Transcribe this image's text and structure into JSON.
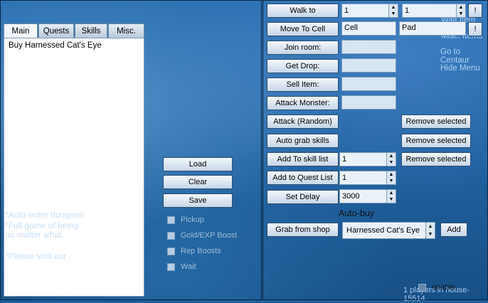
{
  "tabs": [
    "Main",
    "Quests",
    "Skills",
    "Misc."
  ],
  "list_items": [
    "Buy Harnessed Cat's Eye"
  ],
  "left_buttons": {
    "load": "Load",
    "clear": "Clear",
    "save": "Save"
  },
  "checkboxes": [
    "Pickup",
    "Gold/EXP Boost",
    "Rep Boosts",
    "Wait"
  ],
  "ghost_text": [
    "*Auto-enter dungeon",
    "*Full game of being",
    "no matter what.",
    "*Please visit our"
  ],
  "right": {
    "walk_to": "Walk to",
    "walk_x": "1",
    "walk_y": "1",
    "bang": "!",
    "move_to_cell": "Move To Cell",
    "cell": "Cell",
    "pad": "Pad",
    "join_room": "Join room:",
    "get_drop": "Get Drop:",
    "sell_item": "Sell Item:",
    "attack_monster": "Attack Monster:",
    "attack_random": "Attack (Random)",
    "auto_grab_skills": "Auto grab skills",
    "add_to_skill_list": "Add To skill list",
    "skill_value": "1",
    "add_to_quest_list": "Add to Quest List",
    "quest_value": "1",
    "set_delay": "Set Delay",
    "delay_value": "3000",
    "remove_selected": "Remove selected",
    "auto_buy": "Auto-buy",
    "grab_from_shop": "Grab from shop",
    "shop_item": "Harnessed Cat's Eye",
    "add": "Add",
    "enable": "enable"
  },
  "game_menu": [
    "Wait Item",
    "Misc. Items",
    "Go to Centaur",
    "Hide Menu"
  ],
  "footer_text": "1 players in house-15514"
}
